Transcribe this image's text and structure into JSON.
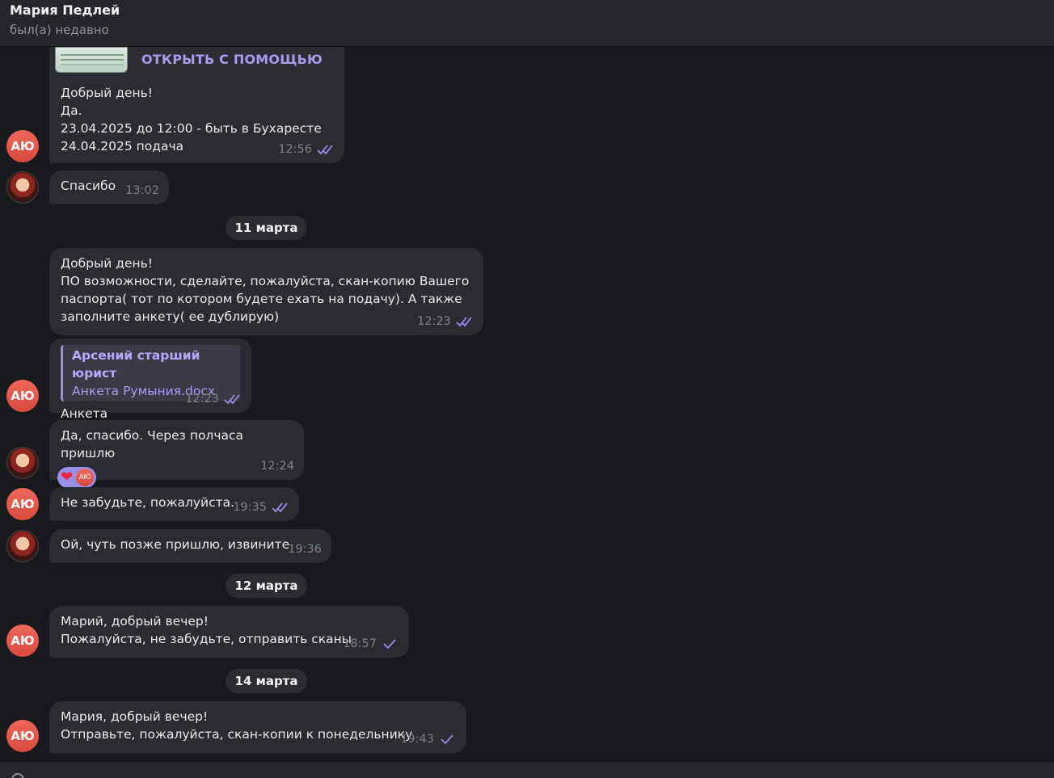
{
  "header": {
    "name": "Мария Педлей",
    "status": "был(а) недавно"
  },
  "file_message": {
    "open_with": "ОТКРЫТЬ С ПОМОЩЬЮ",
    "text": "Добрый день!\nДа.\n23.04.2025 до 12:00 - быть в Бухаресте\n24.04.2025 подача",
    "time": "12:56"
  },
  "messages": [
    {
      "text": "Спасибо",
      "time": "13:02"
    },
    {
      "text": "Добрый день!\nПО возможности, сделайте, пожалуйста, скан-копию Вашего\nпаспорта( тот по котором будете ехать на подачу). А также\nзаполните анкету( ее дублирую)",
      "time": "12:23"
    },
    {
      "reply_author": "Арсений старший юрист",
      "reply_file": "Анкета Румыния.docx",
      "text": "Анкета",
      "time": "12:23"
    },
    {
      "text": "Да, спасибо. Через полчаса пришлю",
      "time": "12:24",
      "reaction_avatar": "АЮ"
    },
    {
      "text": "Не забудьте, пожалуйста.",
      "time": "19:35"
    },
    {
      "text": "Ой, чуть позже пришлю, извините",
      "time": "19:36"
    },
    {
      "text": "Марий, добрый вечер!\nПожалуйста, не забудьте, отправить сканы",
      "time": "18:57"
    },
    {
      "text": "Мария, добрый вечер!\nОтправьте, пожалуйста, скан-копии к понедельнику",
      "time": "19:43"
    }
  ],
  "dates": [
    "11 марта",
    "12 марта",
    "14 марта"
  ],
  "avatar_initials": "АЮ",
  "colors": {
    "accent": "#a99bf0",
    "bubble": "#2b2c31",
    "background": "#18191d",
    "avatar": "#e85a4d"
  },
  "icons": {
    "read": "double-check-icon",
    "sent": "single-check-icon",
    "reaction": "heart-icon"
  }
}
